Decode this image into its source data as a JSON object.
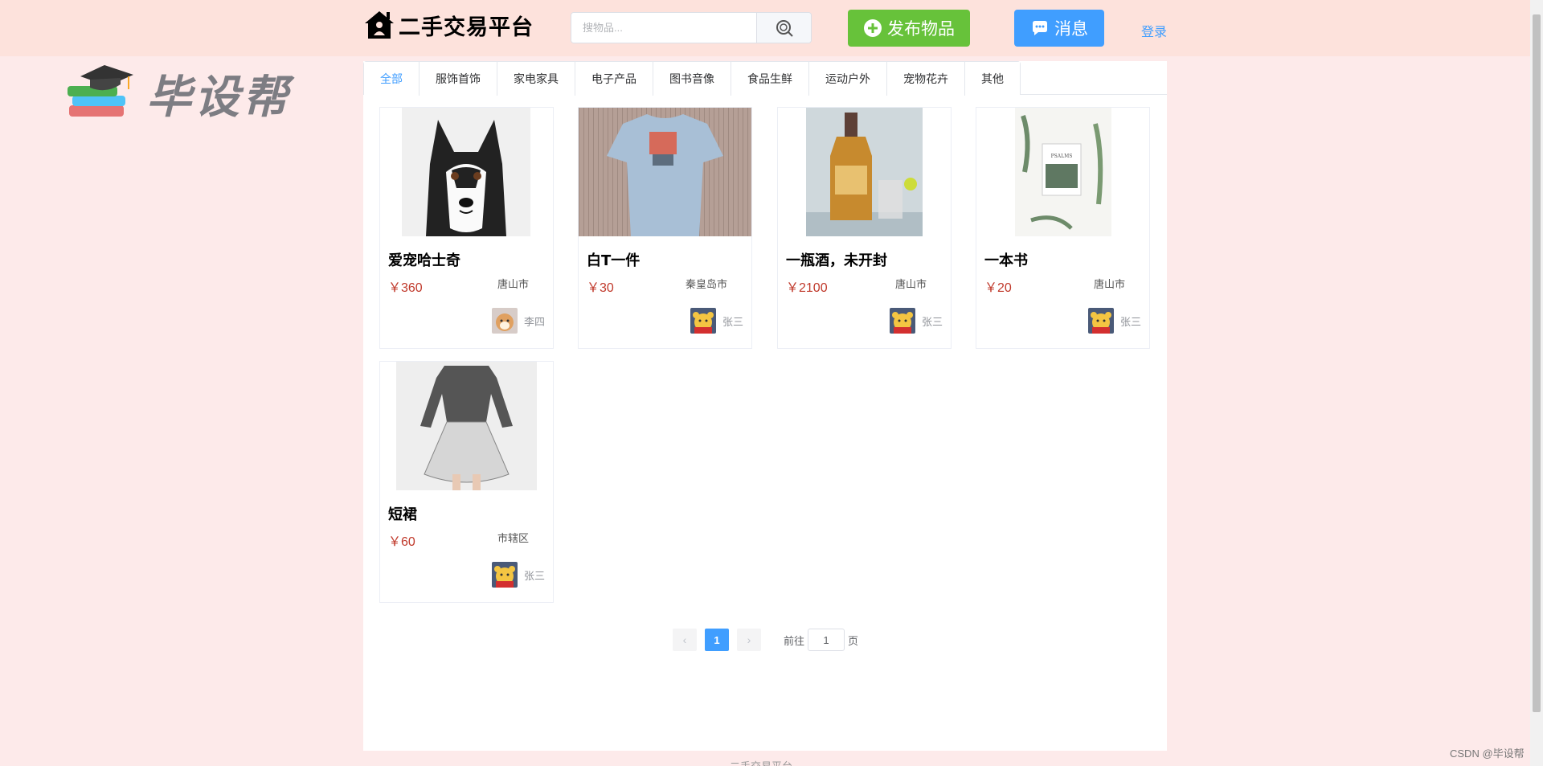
{
  "header": {
    "site_title": "二手交易平台",
    "search_placeholder": "搜物品...",
    "publish_label": "发布物品",
    "message_label": "消息",
    "login_label": "登录"
  },
  "watermark": {
    "text": "毕设帮"
  },
  "tabs": [
    {
      "label": "全部",
      "active": true
    },
    {
      "label": "服饰首饰"
    },
    {
      "label": "家电家具"
    },
    {
      "label": "电子产品"
    },
    {
      "label": "图书音像"
    },
    {
      "label": "食品生鲜"
    },
    {
      "label": "运动户外"
    },
    {
      "label": "宠物花卉"
    },
    {
      "label": "其他"
    }
  ],
  "products": [
    {
      "title": "爱宠哈士奇",
      "price": "￥360",
      "city": "唐山市",
      "user": "李四"
    },
    {
      "title": "白T一件",
      "price": "￥30",
      "city": "秦皇岛市",
      "user": "张三"
    },
    {
      "title": "一瓶酒，未开封",
      "price": "￥2100",
      "city": "唐山市",
      "user": "张三"
    },
    {
      "title": "一本书",
      "price": "￥20",
      "city": "唐山市",
      "user": "张三"
    },
    {
      "title": "短裙",
      "price": "￥60",
      "city": "市辖区",
      "user": "张三"
    }
  ],
  "pagination": {
    "prev": "‹",
    "current": "1",
    "next": "›",
    "goto_label": "前往",
    "goto_value": "1",
    "page_suffix": "页"
  },
  "footer": {
    "text": "二手交易平台"
  },
  "corner_watermark": "CSDN @毕设帮"
}
